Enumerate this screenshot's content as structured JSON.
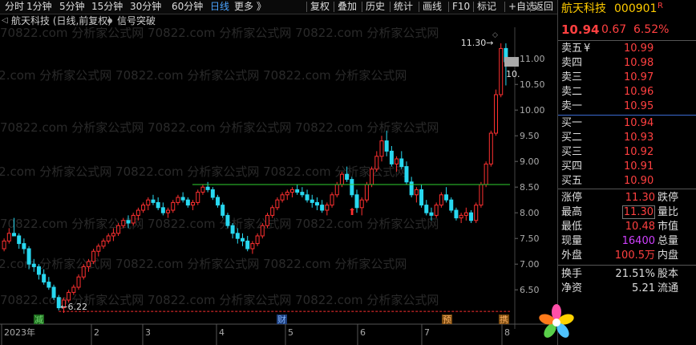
{
  "toolbar": {
    "periods": [
      "分时",
      "1分钟",
      "5分钟",
      "15分钟",
      "30分钟",
      "60分钟",
      "日线",
      "更多 》"
    ],
    "active_period": "日线",
    "actions": [
      "复权",
      "叠加",
      "历史",
      "统计",
      "画线",
      "F10",
      "标记",
      "+自选",
      "返回"
    ]
  },
  "info": {
    "title": "航天科技 (日线,前复权)",
    "indicator": "信号突破"
  },
  "quote": {
    "name": "航天科技",
    "code": "000901",
    "badge": "R",
    "price": "10.94",
    "change": "0.67",
    "change_pct": "6.52%"
  },
  "orderbook": {
    "asks": [
      {
        "label": "卖五",
        "extra": "¥",
        "price": "10.99"
      },
      {
        "label": "卖四",
        "extra": "",
        "price": "10.98"
      },
      {
        "label": "卖三",
        "extra": "",
        "price": "10.97"
      },
      {
        "label": "卖二",
        "extra": "",
        "price": "10.96"
      },
      {
        "label": "卖一",
        "extra": "",
        "price": "10.95"
      }
    ],
    "bids": [
      {
        "label": "买一",
        "price": "10.94"
      },
      {
        "label": "买二",
        "price": "10.93"
      },
      {
        "label": "买三",
        "price": "10.92"
      },
      {
        "label": "买四",
        "price": "10.91"
      },
      {
        "label": "买五",
        "price": "10.90"
      }
    ]
  },
  "stats": [
    {
      "label": "涨停",
      "value": "11.30",
      "color": "#ff4040",
      "right": "跌停"
    },
    {
      "label": "最高",
      "value": "11.30",
      "color": "#ff4040",
      "right": "量比",
      "boxed": true
    },
    {
      "label": "最低",
      "value": "10.48",
      "color": "#ff4040",
      "right": "市值"
    },
    {
      "label": "现量",
      "value": "16400",
      "color": "#d040ff",
      "right": "总量"
    },
    {
      "label": "外盘",
      "value": "100.5万",
      "color": "#ff4040",
      "right": "内盘"
    },
    {
      "label": "换手",
      "value": "21.51%",
      "color": "#dddddd",
      "right": "股本"
    },
    {
      "label": "净资",
      "value": "5.21",
      "color": "#dddddd",
      "right": "流通"
    }
  ],
  "chart_data": {
    "type": "candlestick",
    "yaxis_ticks": [
      "11.00",
      "10.50",
      "10.00",
      "9.50",
      "9.00",
      "8.50",
      "8.00",
      "7.50",
      "7.00",
      "6.50"
    ],
    "ylim": [
      6.05,
      11.55
    ],
    "xaxis_labels": [
      "2023年",
      "2",
      "3",
      "4",
      "5",
      "6",
      "7",
      "8"
    ],
    "annotations": {
      "high_label": "11.30",
      "low_label": "6.22",
      "last_label": "10."
    },
    "support_level": 8.55,
    "event_markers": [
      "减",
      "财",
      "预",
      "携"
    ],
    "watermark": "70822.com 分析家公式网",
    "candles": [
      [
        7.3,
        7.5,
        7.25,
        7.45
      ],
      [
        7.45,
        7.7,
        7.4,
        7.6
      ],
      [
        7.6,
        7.9,
        7.55,
        7.55
      ],
      [
        7.55,
        7.6,
        7.3,
        7.4
      ],
      [
        7.4,
        7.5,
        7.2,
        7.3
      ],
      [
        7.3,
        7.35,
        6.9,
        7.0
      ],
      [
        7.0,
        7.1,
        6.85,
        6.95
      ],
      [
        6.95,
        7.0,
        6.7,
        6.8
      ],
      [
        6.8,
        6.9,
        6.6,
        6.65
      ],
      [
        6.65,
        6.75,
        6.5,
        6.55
      ],
      [
        6.55,
        6.6,
        6.3,
        6.35
      ],
      [
        6.35,
        6.4,
        6.1,
        6.15
      ],
      [
        6.15,
        6.35,
        6.05,
        6.3
      ],
      [
        6.3,
        6.5,
        6.25,
        6.45
      ],
      [
        6.45,
        6.6,
        6.4,
        6.55
      ],
      [
        6.55,
        6.8,
        6.5,
        6.75
      ],
      [
        6.75,
        7.0,
        6.7,
        6.95
      ],
      [
        6.95,
        7.1,
        6.85,
        7.05
      ],
      [
        7.05,
        7.3,
        7.0,
        7.25
      ],
      [
        7.25,
        7.4,
        7.15,
        7.35
      ],
      [
        7.35,
        7.5,
        7.3,
        7.45
      ],
      [
        7.45,
        7.6,
        7.4,
        7.55
      ],
      [
        7.55,
        7.7,
        7.45,
        7.6
      ],
      [
        7.6,
        7.8,
        7.55,
        7.75
      ],
      [
        7.75,
        7.9,
        7.7,
        7.85
      ],
      [
        7.85,
        7.95,
        7.7,
        7.8
      ],
      [
        7.8,
        8.0,
        7.75,
        7.95
      ],
      [
        7.95,
        8.1,
        7.85,
        8.05
      ],
      [
        8.05,
        8.2,
        8.0,
        8.15
      ],
      [
        8.15,
        8.3,
        8.05,
        8.25
      ],
      [
        8.25,
        8.35,
        8.15,
        8.2
      ],
      [
        8.2,
        8.3,
        8.05,
        8.1
      ],
      [
        8.1,
        8.2,
        7.95,
        8.0
      ],
      [
        8.0,
        8.1,
        7.9,
        8.05
      ],
      [
        8.05,
        8.25,
        8.0,
        8.2
      ],
      [
        8.2,
        8.35,
        8.15,
        8.3
      ],
      [
        8.3,
        8.4,
        8.2,
        8.25
      ],
      [
        8.25,
        8.3,
        8.1,
        8.15
      ],
      [
        8.15,
        8.25,
        8.05,
        8.2
      ],
      [
        8.2,
        8.45,
        8.15,
        8.4
      ],
      [
        8.4,
        8.55,
        8.35,
        8.5
      ],
      [
        8.5,
        8.6,
        8.4,
        8.45
      ],
      [
        8.45,
        8.5,
        8.25,
        8.3
      ],
      [
        8.3,
        8.35,
        8.1,
        8.15
      ],
      [
        8.15,
        8.2,
        7.9,
        7.95
      ],
      [
        7.95,
        8.0,
        7.7,
        7.75
      ],
      [
        7.75,
        7.8,
        7.5,
        7.6
      ],
      [
        7.6,
        7.7,
        7.4,
        7.5
      ],
      [
        7.5,
        7.6,
        7.35,
        7.45
      ],
      [
        7.45,
        7.55,
        7.25,
        7.3
      ],
      [
        7.3,
        7.45,
        7.2,
        7.4
      ],
      [
        7.4,
        7.6,
        7.35,
        7.55
      ],
      [
        7.55,
        7.8,
        7.5,
        7.75
      ],
      [
        7.75,
        8.0,
        7.7,
        7.95
      ],
      [
        7.95,
        8.15,
        7.9,
        8.1
      ],
      [
        8.1,
        8.3,
        8.05,
        8.25
      ],
      [
        8.25,
        8.4,
        8.2,
        8.35
      ],
      [
        8.35,
        8.45,
        8.25,
        8.4
      ],
      [
        8.4,
        8.5,
        8.3,
        8.45
      ],
      [
        8.45,
        8.55,
        8.35,
        8.4
      ],
      [
        8.4,
        8.5,
        8.3,
        8.35
      ],
      [
        8.35,
        8.45,
        8.2,
        8.25
      ],
      [
        8.25,
        8.35,
        8.1,
        8.2
      ],
      [
        8.2,
        8.3,
        8.05,
        8.15
      ],
      [
        8.15,
        8.25,
        8.0,
        8.05
      ],
      [
        8.05,
        8.2,
        7.95,
        8.15
      ],
      [
        8.15,
        8.4,
        8.1,
        8.35
      ],
      [
        8.35,
        8.6,
        8.3,
        8.55
      ],
      [
        8.55,
        8.8,
        8.5,
        8.75
      ],
      [
        8.75,
        8.9,
        8.6,
        8.65
      ],
      [
        8.65,
        8.7,
        8.3,
        8.35
      ],
      [
        8.35,
        8.45,
        8.0,
        8.1
      ],
      [
        8.1,
        8.3,
        7.95,
        8.25
      ],
      [
        8.25,
        8.6,
        8.2,
        8.55
      ],
      [
        8.55,
        8.9,
        8.5,
        8.85
      ],
      [
        8.85,
        9.2,
        8.8,
        9.1
      ],
      [
        9.1,
        9.5,
        9.0,
        9.4
      ],
      [
        9.4,
        9.6,
        9.1,
        9.2
      ],
      [
        9.2,
        9.3,
        8.9,
        8.95
      ],
      [
        8.95,
        9.1,
        8.8,
        9.05
      ],
      [
        9.05,
        9.2,
        8.85,
        8.9
      ],
      [
        8.9,
        9.0,
        8.55,
        8.6
      ],
      [
        8.6,
        8.7,
        8.3,
        8.35
      ],
      [
        8.35,
        8.5,
        8.2,
        8.45
      ],
      [
        8.45,
        8.55,
        8.1,
        8.15
      ],
      [
        8.15,
        8.25,
        7.95,
        8.0
      ],
      [
        8.0,
        8.1,
        7.85,
        7.95
      ],
      [
        7.95,
        8.2,
        7.9,
        8.15
      ],
      [
        8.15,
        8.4,
        8.1,
        8.35
      ],
      [
        8.35,
        8.5,
        8.2,
        8.25
      ],
      [
        8.25,
        8.3,
        8.0,
        8.05
      ],
      [
        8.05,
        8.1,
        7.85,
        7.9
      ],
      [
        7.9,
        8.0,
        7.8,
        7.95
      ],
      [
        7.95,
        8.1,
        7.85,
        8.0
      ],
      [
        8.0,
        8.05,
        7.8,
        7.85
      ],
      [
        7.85,
        8.2,
        7.8,
        8.15
      ],
      [
        8.15,
        8.6,
        8.1,
        8.55
      ],
      [
        8.55,
        9.0,
        8.5,
        8.95
      ],
      [
        8.95,
        9.6,
        8.9,
        9.55
      ],
      [
        9.55,
        10.4,
        9.5,
        10.3
      ],
      [
        10.3,
        11.3,
        10.25,
        11.2
      ],
      [
        11.2,
        11.3,
        10.48,
        10.94
      ]
    ]
  }
}
